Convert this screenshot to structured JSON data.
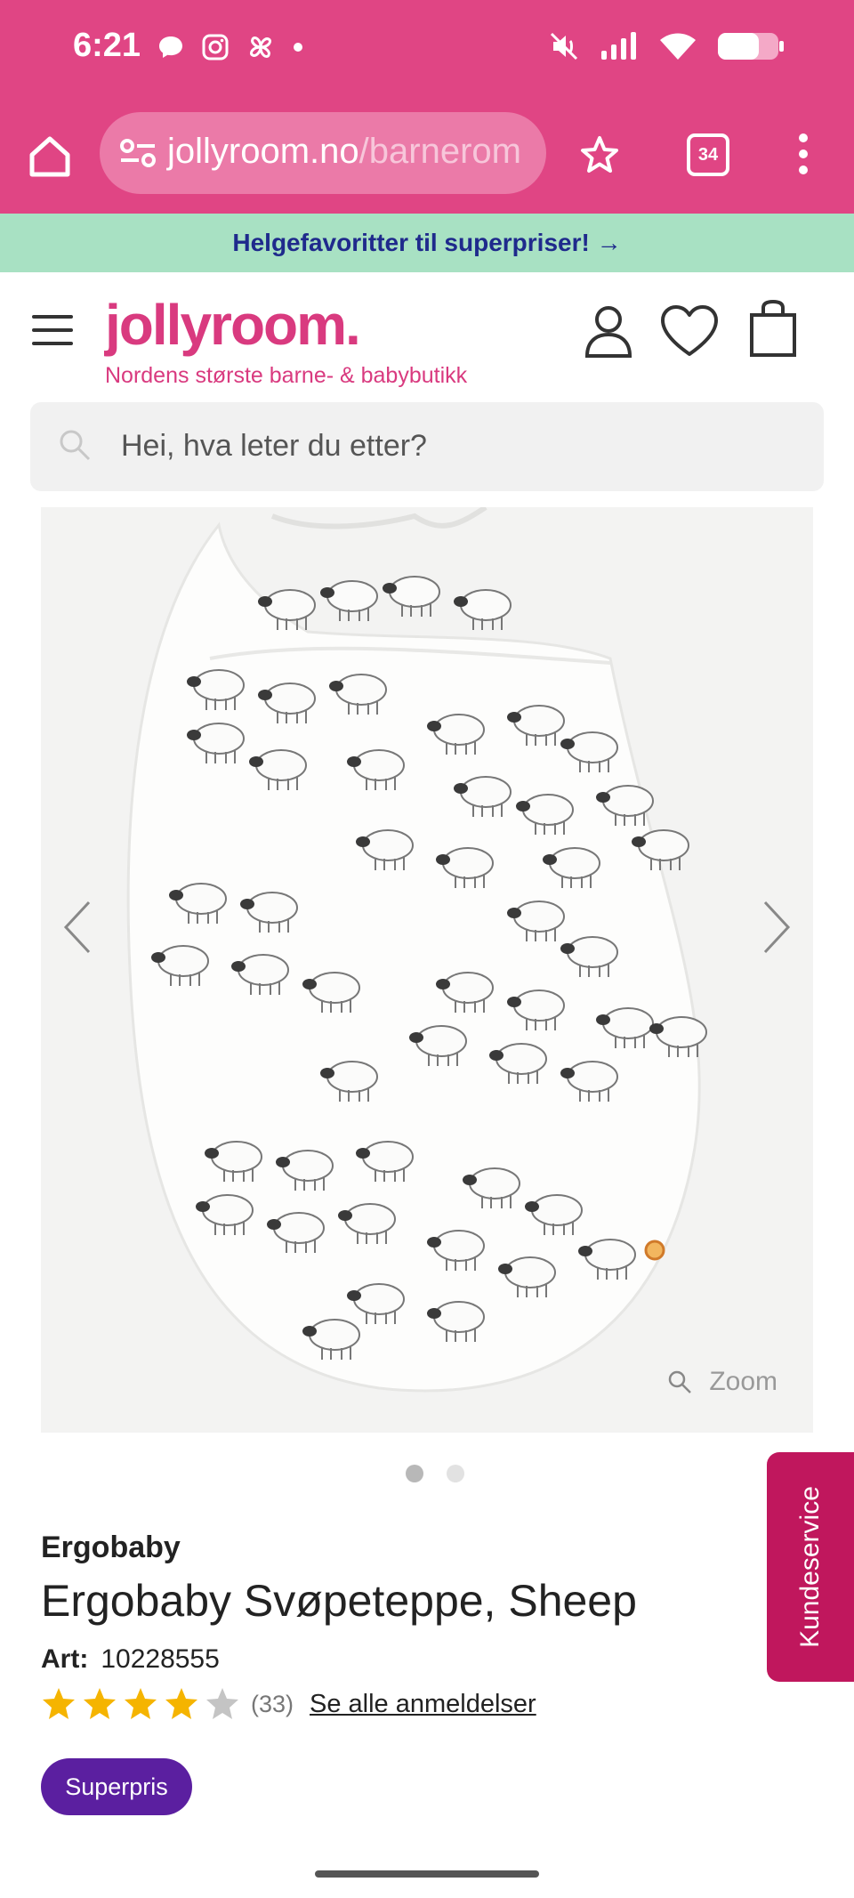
{
  "status_bar": {
    "time": "6:21",
    "left_icons": [
      "chat-bubble-icon",
      "instagram-icon",
      "pinwheel-icon",
      "dot-icon"
    ],
    "right_icons": [
      "mute-icon",
      "signal-icon",
      "wifi-icon",
      "battery-icon"
    ]
  },
  "browser": {
    "url_main": "jollyroom.no",
    "url_path": "/barnerom",
    "tab_count": "34"
  },
  "promo": {
    "text": "Helgefavoritter til superpriser! →"
  },
  "header": {
    "logo": "jollyroom.",
    "tagline": "Nordens største barne- & babybutikk"
  },
  "search": {
    "placeholder": "Hei, hva leter du etter?"
  },
  "product_image": {
    "zoom_label": "Zoom",
    "slide_count": 2,
    "active_slide": 1
  },
  "product": {
    "brand": "Ergobaby",
    "title": "Ergobaby Svøpeteppe, Sheep",
    "art_label": "Art:",
    "art_number": "10228555",
    "rating": 4,
    "rating_max": 5,
    "review_count": "(33)",
    "all_reviews_label": "Se alle anmeldelser",
    "badge": "Superpris"
  },
  "kundeservice": {
    "label": "Kundeservice"
  },
  "colors": {
    "chrome": "#e04584",
    "brand": "#d93a7f",
    "promo_bg": "#a8e1c3",
    "promo_text": "#1f2a8c",
    "badge": "#5b1fa0",
    "kundeservice": "#c0175d",
    "star": "#f5b400"
  }
}
